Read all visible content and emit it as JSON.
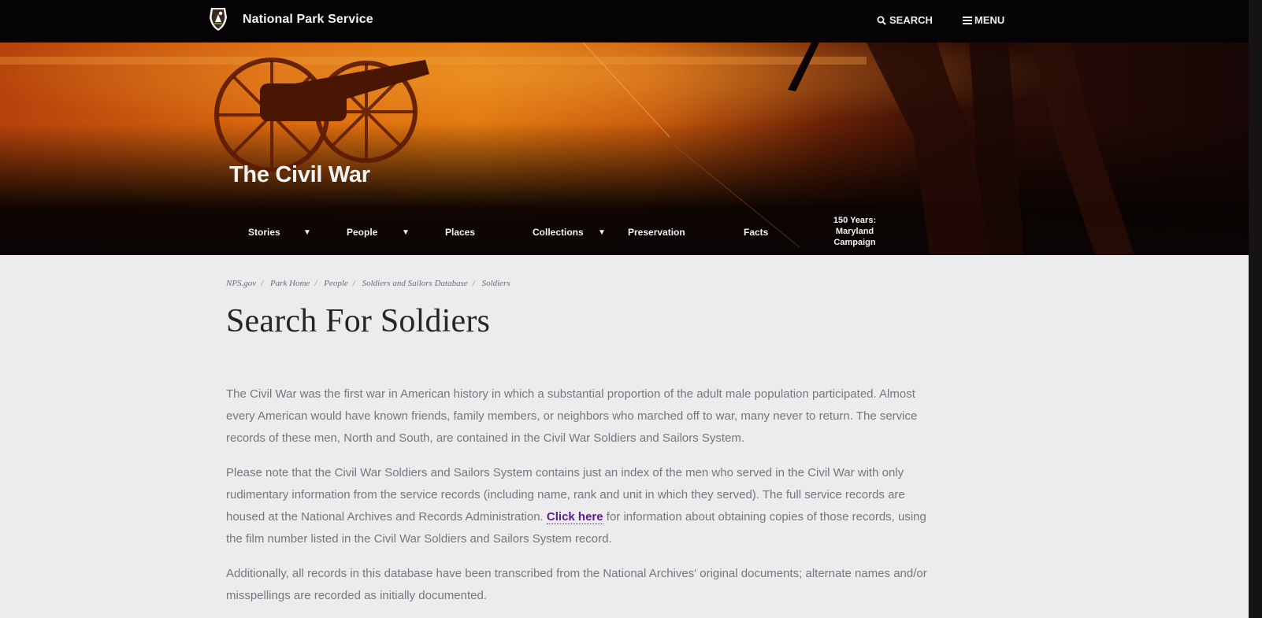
{
  "header": {
    "site_name": "National Park Service",
    "search_label": "SEARCH",
    "menu_label": "MENU"
  },
  "hero": {
    "title": "The Civil War",
    "nav": [
      {
        "label": "Stories",
        "dropdown": true
      },
      {
        "label": "People",
        "dropdown": true
      },
      {
        "label": "Places",
        "dropdown": false
      },
      {
        "label": "Collections",
        "dropdown": true
      },
      {
        "label": "Preservation",
        "dropdown": false
      },
      {
        "label": "Facts",
        "dropdown": false
      },
      {
        "label": "150 Years: Maryland Campaign",
        "lines": [
          "150 Years:",
          "Maryland",
          "Campaign"
        ],
        "dropdown": false
      }
    ]
  },
  "breadcrumb": [
    "NPS.gov",
    "Park Home",
    "People",
    "Soldiers and Sailors Database",
    "Soldiers"
  ],
  "main": {
    "title": "Search For Soldiers",
    "para1_lines": [
      "The Civil War was the first war in American history in which a substantial proportion of the adult male population participated. Almost",
      "every American would have known friends, family members, or neighbors who marched off to war, many never to return. The service",
      "records of these men, North and South, are contained in the Civil War Soldiers and Sailors System."
    ],
    "para2_lines": [
      "Please note that the Civil War Soldiers and Sailors System contains just an index of the men who served in the Civil War with only",
      "rudimentary information from the service records (including name, rank and unit in which they served). The full service records are"
    ],
    "para2_line3_before": "housed at the National Archives and Records Administration. ",
    "para2_link": "Click here",
    "para2_line3_after": " for information about obtaining copies of those records, using",
    "para2_line4": "the film number listed in the Civil War Soldiers and Sailors System record.",
    "para3_lines": [
      "Additionally, all records in this database have been transcribed from the National Archives' original documents; alternate names and/or",
      "misspellings are recorded as initially documented."
    ]
  },
  "colors": {
    "top_bar": "#050306",
    "link": "#5a1e8c",
    "body_text": "#77777b",
    "title_text": "#262628"
  },
  "icons": [
    "nps-arrowhead-logo",
    "search-icon",
    "menu-icon",
    "caret-down-icon"
  ]
}
